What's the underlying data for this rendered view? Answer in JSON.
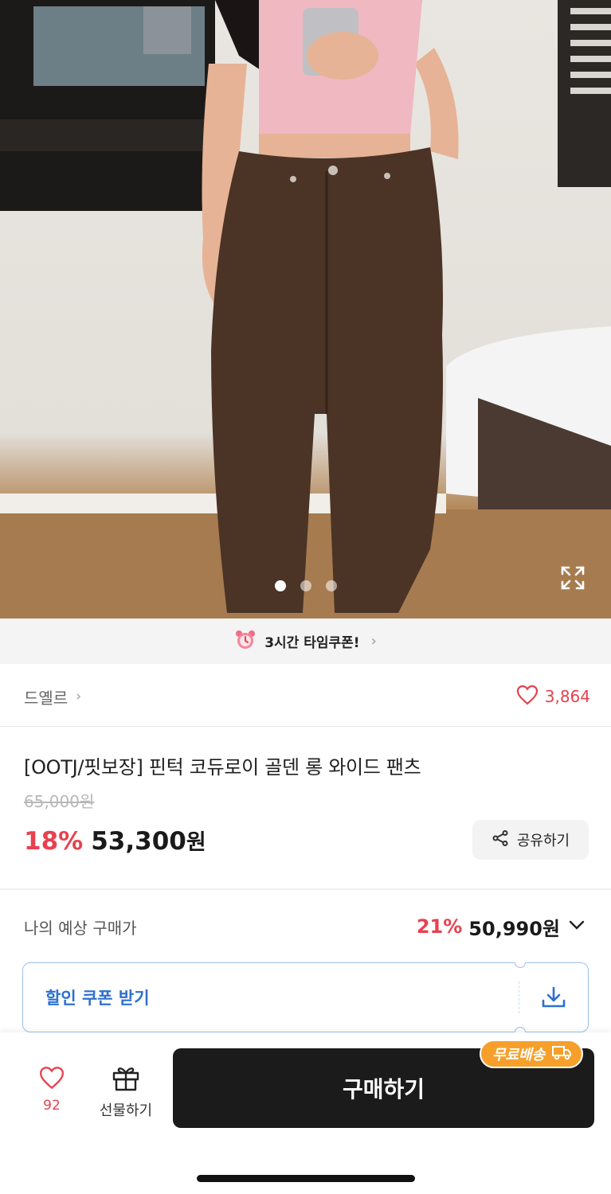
{
  "gallery": {
    "image_alt": "Brown corduroy wide pants worn with pink crop top",
    "page_count": 3,
    "active_index": 0
  },
  "time_coupon": {
    "label": "3시간 타임쿠폰!",
    "icon": "alarm-clock-icon"
  },
  "brand": {
    "name": "드옐르",
    "like_count": "3,864"
  },
  "product": {
    "title": "[OOTJ/핏보장] 핀턱 코듀로이 골덴 롱 와이드 팬츠",
    "original_price": "65,000원",
    "discount_rate": "18%",
    "price_number": "53,300",
    "price_unit": "원",
    "share_label": "공유하기"
  },
  "expected": {
    "label": "나의 예상 구매가",
    "discount_rate": "21%",
    "price": "50,990원"
  },
  "coupon": {
    "label": "할인 쿠폰 받기"
  },
  "bottom_bar": {
    "like_count": "92",
    "gift_label": "선물하기",
    "buy_label": "구매하기",
    "free_shipping_label": "무료배송"
  },
  "colors": {
    "accent_red": "#e8414f",
    "coupon_blue": "#2e6fd0",
    "buy_button": "#1b1b1b",
    "free_ship_badge": "#f6a02b"
  }
}
